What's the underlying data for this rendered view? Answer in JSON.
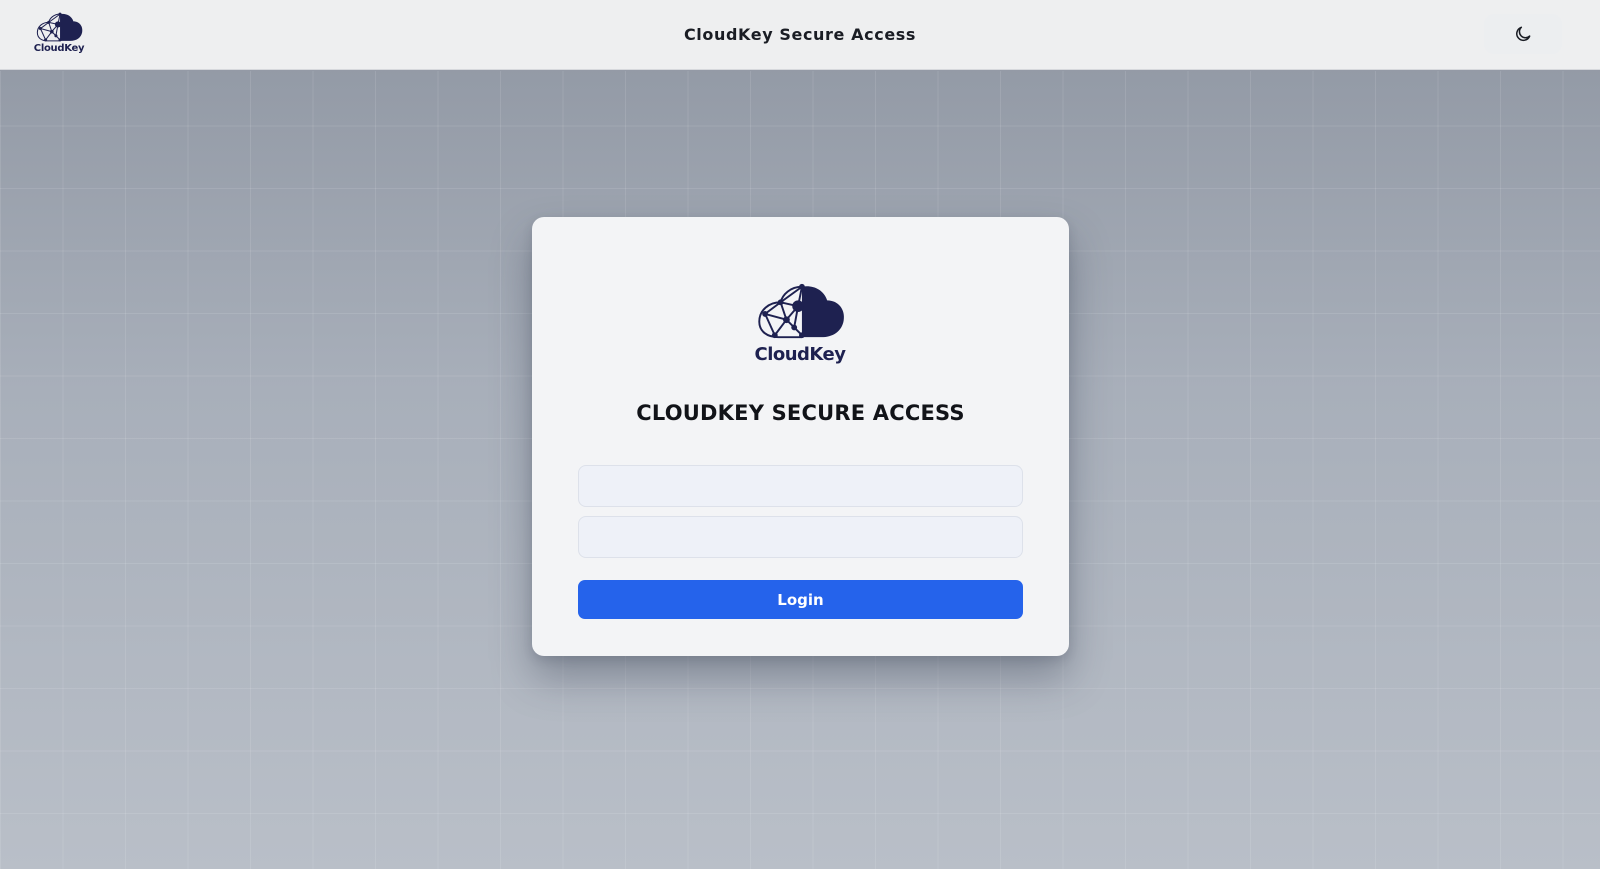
{
  "header": {
    "logo_text": "CloudKey",
    "title": "CloudKey Secure Access",
    "theme_toggle_icon": "moon-icon"
  },
  "card": {
    "logo_text": "CloudKey",
    "title": "CLOUDKEY SECURE ACCESS",
    "username": {
      "value": "",
      "placeholder": ""
    },
    "password": {
      "value": "",
      "placeholder": ""
    },
    "login_label": "Login"
  },
  "colors": {
    "brand_navy": "#1e2150",
    "button_blue": "#2563eb",
    "header_bg": "#eeeff0",
    "card_bg": "#f3f4f6"
  }
}
